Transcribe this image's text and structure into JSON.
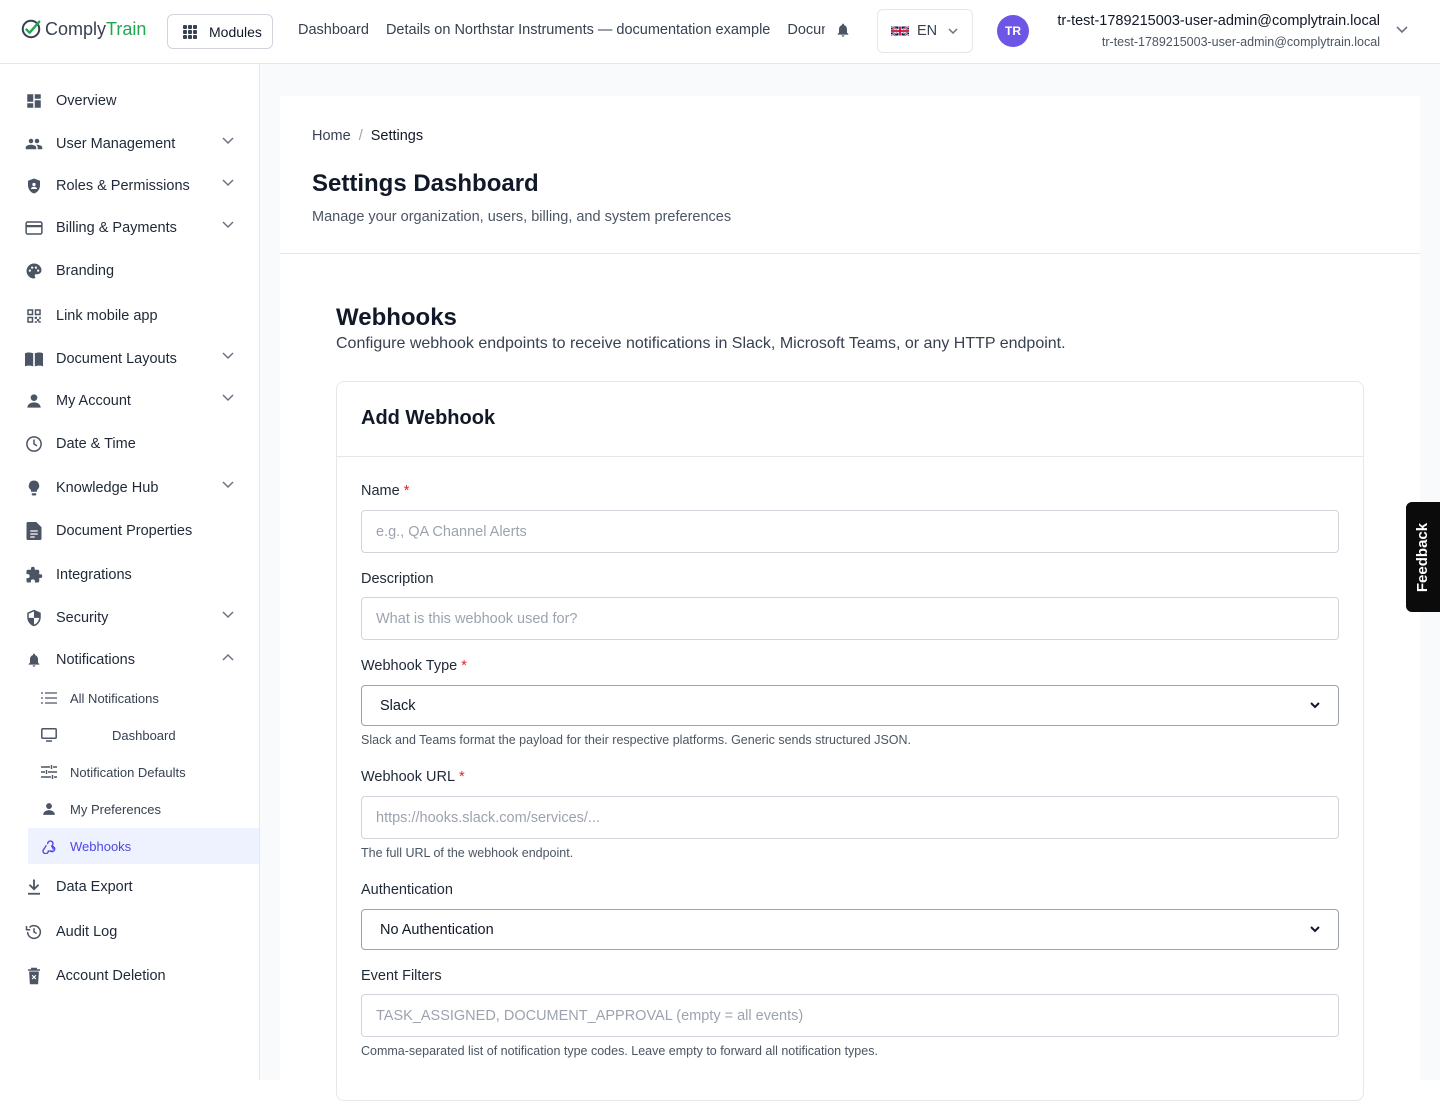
{
  "app": {
    "logo_part1": "Comply",
    "logo_part2": "Train",
    "modules_label": "Modules",
    "top_nav": [
      "Dashboard",
      "Details on Northstar Instruments — documentation example",
      "Documents"
    ],
    "language": "EN",
    "user_initials": "TR",
    "user_name": "tr-test-1789215003-user-admin@complytrain.local",
    "user_email": "tr-test-1789215003-user-admin@complytrain.local",
    "feedback_label": "Feedback"
  },
  "sidebar": {
    "items": [
      {
        "label": "Overview",
        "icon": "dashboard-icon",
        "chevron": false
      },
      {
        "label": "User Management",
        "icon": "users-icon",
        "chevron": true
      },
      {
        "label": "Roles & Permissions",
        "icon": "shield-person-icon",
        "chevron": true
      },
      {
        "label": "Billing & Payments",
        "icon": "credit-card-icon",
        "chevron": true
      },
      {
        "label": "Branding",
        "icon": "palette-icon",
        "chevron": false
      },
      {
        "label": "Link mobile app",
        "icon": "qr-code-icon",
        "chevron": false
      },
      {
        "label": "Document Layouts",
        "icon": "book-icon",
        "chevron": true
      },
      {
        "label": "My Account",
        "icon": "person-icon",
        "chevron": true
      },
      {
        "label": "Date & Time",
        "icon": "clock-icon",
        "chevron": false
      },
      {
        "label": "Knowledge Hub",
        "icon": "lightbulb-icon",
        "chevron": true
      },
      {
        "label": "Document Properties",
        "icon": "document-icon",
        "chevron": false
      },
      {
        "label": "Integrations",
        "icon": "puzzle-icon",
        "chevron": false
      },
      {
        "label": "Security",
        "icon": "shield-icon",
        "chevron": true
      },
      {
        "label": "Notifications",
        "icon": "bell-icon",
        "chevron": true,
        "expanded": true
      },
      {
        "label": "Data Export",
        "icon": "download-icon",
        "chevron": false
      },
      {
        "label": "Audit Log",
        "icon": "history-icon",
        "chevron": false
      },
      {
        "label": "Account Deletion",
        "icon": "delete-icon",
        "chevron": false
      }
    ],
    "sub_items": [
      {
        "label": "All Notifications",
        "icon": "list-icon"
      },
      {
        "label": "Dashboard",
        "icon": "monitor-icon"
      },
      {
        "label": "Notification Defaults",
        "icon": "tune-icon"
      },
      {
        "label": "My Preferences",
        "icon": "person-icon"
      },
      {
        "label": "Webhooks",
        "icon": "webhook-icon",
        "active": true
      }
    ]
  },
  "page": {
    "breadcrumb_home": "Home",
    "breadcrumb_sep": "/",
    "breadcrumb_current": "Settings",
    "title": "Settings Dashboard",
    "subtitle": "Manage your organization, users, billing, and system preferences"
  },
  "webhooks": {
    "title": "Webhooks",
    "subtitle": "Configure webhook endpoints to receive notifications in Slack, Microsoft Teams, or any HTTP endpoint.",
    "form_title": "Add Webhook",
    "name_label": "Name",
    "name_placeholder": "e.g., QA Channel Alerts",
    "description_label": "Description",
    "description_placeholder": "What is this webhook used for?",
    "type_label": "Webhook Type",
    "type_value": "Slack",
    "type_help": "Slack and Teams format the payload for their respective platforms. Generic sends structured JSON.",
    "url_label": "Webhook URL",
    "url_placeholder": "https://hooks.slack.com/services/...",
    "url_help": "The full URL of the webhook endpoint.",
    "auth_label": "Authentication",
    "auth_value": "No Authentication",
    "filters_label": "Event Filters",
    "filters_placeholder": "TASK_ASSIGNED, DOCUMENT_APPROVAL (empty = all events)",
    "filters_help": "Comma-separated list of notification type codes. Leave empty to forward all notification types.",
    "required_mark": "*"
  },
  "colors": {
    "brand_green": "#22a652",
    "accent": "#4f46e5",
    "avatar": "#6d55e6",
    "required": "#dc2626"
  }
}
